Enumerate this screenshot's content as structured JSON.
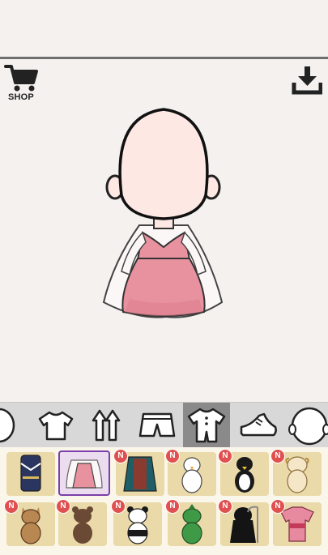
{
  "header": {
    "shop_label": "SHOP"
  },
  "toolbar": {
    "tools": [
      {
        "name": "head",
        "icon": "head-icon",
        "active": false
      },
      {
        "name": "tshirt",
        "icon": "tshirt-icon",
        "active": false
      },
      {
        "name": "arrows",
        "icon": "arrows-icon",
        "active": false
      },
      {
        "name": "shorts",
        "icon": "shorts-icon",
        "active": false
      },
      {
        "name": "onesie",
        "icon": "onesie-icon",
        "active": true
      },
      {
        "name": "shoe",
        "icon": "shoe-icon",
        "active": false
      },
      {
        "name": "face",
        "icon": "face-icon",
        "active": false
      }
    ]
  },
  "outfits": {
    "badge_label": "N",
    "items": [
      {
        "name": "navy-hanbok",
        "badge": false,
        "selected": false
      },
      {
        "name": "pink-dress",
        "badge": false,
        "selected": true
      },
      {
        "name": "teal-cape",
        "badge": true,
        "selected": false
      },
      {
        "name": "chick-costume",
        "badge": true,
        "selected": false
      },
      {
        "name": "penguin-costume",
        "badge": true,
        "selected": false
      },
      {
        "name": "sheep-costume",
        "badge": true,
        "selected": false
      },
      {
        "name": "fox-costume",
        "badge": true,
        "selected": false
      },
      {
        "name": "bear-costume",
        "badge": true,
        "selected": false
      },
      {
        "name": "panda-costume",
        "badge": true,
        "selected": false
      },
      {
        "name": "dinosaur-costume",
        "badge": true,
        "selected": false
      },
      {
        "name": "reaper-costume",
        "badge": true,
        "selected": false
      },
      {
        "name": "pink-kimono",
        "badge": true,
        "selected": false
      }
    ]
  },
  "colors": {
    "accent": "#7a3fa8",
    "dress": "#e8929f",
    "badge": "#e05050",
    "cell": "#ead9a9"
  }
}
